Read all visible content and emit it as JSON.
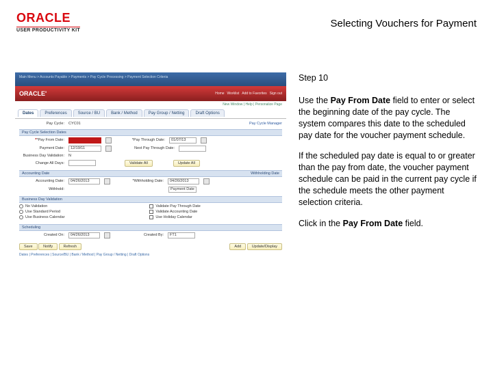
{
  "header": {
    "logo_brand": "ORACLE",
    "logo_sub": "USER PRODUCTIVITY KIT",
    "title": "Selecting Vouchers for Payment"
  },
  "content": {
    "step_label": "Step 10",
    "para1a": "Use the ",
    "para1_bold": "Pay From Date",
    "para1b": " field to enter or select the beginning date of the pay cycle. The system compares this date to the scheduled pay date for the voucher payment schedule.",
    "para2": "If the scheduled pay date is equal to or greater than the pay from date, the voucher payment schedule can be paid in the current pay cycle if the schedule meets the other payment selection criteria.",
    "para3a": "Click in the ",
    "para3_bold": "Pay From Date",
    "para3b": " field."
  },
  "shot": {
    "top_breadcrumb": "Main Menu > Accounts Payable > Payments > Pay Cycle Processing > Payment Selection Criteria",
    "brand": "ORACLE'",
    "brand_links": [
      "Home",
      "Worklist",
      "Add to Favorites",
      "Sign out"
    ],
    "subbar": "New Window | Help | Personalize Page",
    "tabs": [
      "Dates",
      "Preferences",
      "Source / BU",
      "Bank / Method",
      "Pay Group / Netting",
      "Draft Options"
    ],
    "pay_cycle_label": "Pay Cycle:",
    "pay_cycle_value": "CYC01",
    "manager": "Pay Cycle Manager",
    "sec_sel": "Pay Cycle Selection Dates",
    "from_label": "*Pay From Date:",
    "from_value": "",
    "through_label": "*Pay Through Date:",
    "through_value": "01/07/13",
    "pmt_label": "Payment Date:",
    "pmt_value": "12/19/11",
    "next_label": "Next Pay Through Date:",
    "next_value": "",
    "bdlabel": "Business Day Validation:",
    "bdvalue": "N",
    "changed_label": "Change All Days:",
    "days_value": "",
    "validate_btn": "Validate All",
    "update_btn": "Update All",
    "sec_acc": "Accounting Date",
    "acc_label": "Accounting Date:",
    "acc_value": "04/26/2013",
    "sec_wh": "Withholding Date",
    "wh_label": "*Withholding Date:",
    "wh_value": "04/26/2013",
    "wh_opt_label": "Withhold:",
    "wh_opt_value": "Payment Date",
    "sec_bd": "Business Day Validation",
    "radios": [
      "No Validation",
      "Use Standard Period",
      "Use Business Calendar"
    ],
    "checks": [
      "Validate Pay Through Date",
      "Validate Accounting Date",
      "Use Holiday Calendar"
    ],
    "sec_sch": "Scheduling",
    "sch_on_label": "Created On:",
    "sch_on_value": "04/26/2013",
    "sch_by_label": "Created By:",
    "sch_by_value": "FT1",
    "footer_btns": [
      "Save",
      "Notify",
      "Refresh"
    ],
    "footer_btns_right": [
      "Add",
      "Update/Display"
    ],
    "footer_links": "Dates | Preferences | Source/BU | Bank / Method | Pay Group / Netting | Draft Options"
  }
}
